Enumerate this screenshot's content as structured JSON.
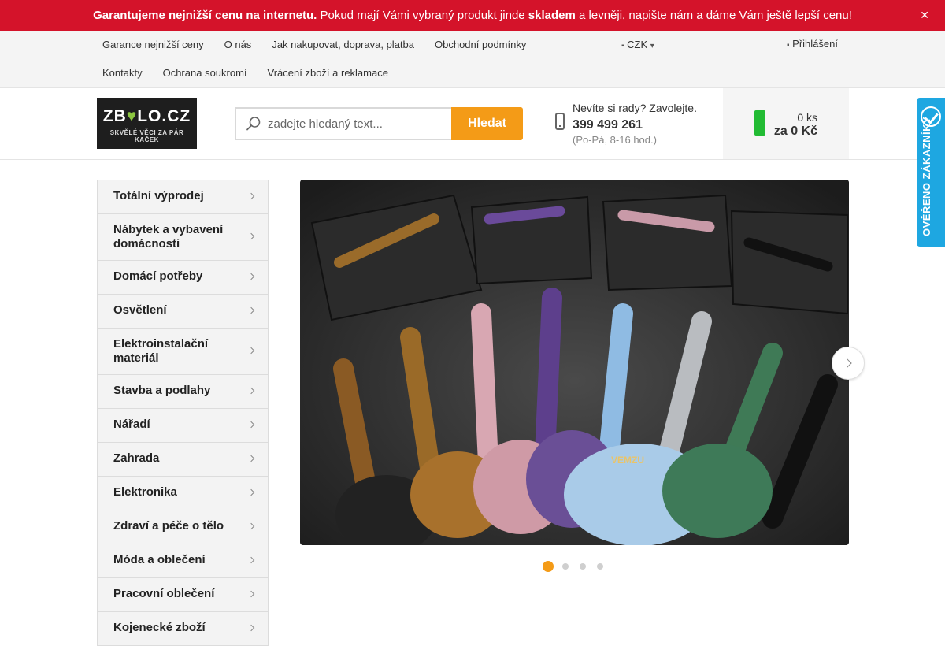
{
  "promo": {
    "lead": "Garantujeme nejnižší cenu na internetu.",
    "text1": " Pokud mají Vámi vybraný produkt jinde ",
    "bold": "skladem",
    "text2": " a levněji, ",
    "link": "napište nám",
    "text3": " a dáme Vám ještě lepší cenu!",
    "close_icon": "close-icon"
  },
  "topnav": {
    "row1": [
      "Garance nejnižší ceny",
      "O nás",
      "Jak nakupovat, doprava, platba",
      "Obchodní podmínky"
    ],
    "row2": [
      "Kontakty",
      "Ochrana soukromí",
      "Vrácení zboží a reklamace"
    ],
    "currency": "CZK",
    "login": "Přihlášení"
  },
  "logo": {
    "name_a": "ZB",
    "name_b": "LO.CZ",
    "tagline": "SKVĚLÉ VĚCI ZA PÁR KAČEK"
  },
  "search": {
    "placeholder": "zadejte hledaný text...",
    "button": "Hledat"
  },
  "contact": {
    "question": "Nevíte si rady? Zavolejte.",
    "phone": "399 499 261",
    "hours": "(Po-Pá, 8-16 hod.)"
  },
  "cart": {
    "count": "0 ks",
    "total": "za 0 Kč"
  },
  "verified": {
    "label": "OVĚŘENO ZÁKAZNÍKY"
  },
  "sidebar": {
    "items": [
      "Totální výprodej",
      "Nábytek a vybavení domácnosti",
      "Domácí potřeby",
      "Osvětlení",
      "Elektroinstalační materiál",
      "Stavba a podlahy",
      "Nářadí",
      "Zahrada",
      "Elektronika",
      "Zdraví a péče o tělo",
      "Móda a oblečení",
      "Pracovní oblečení",
      "Kojenecké zboží"
    ]
  },
  "banner": {
    "brand": "VEMZU",
    "active_slide": 1,
    "slide_count": 4
  },
  "colors": {
    "promo": "#d4132a",
    "accent": "#f49b17",
    "cart_icon": "#22bb33",
    "verified": "#1ea7e1"
  }
}
